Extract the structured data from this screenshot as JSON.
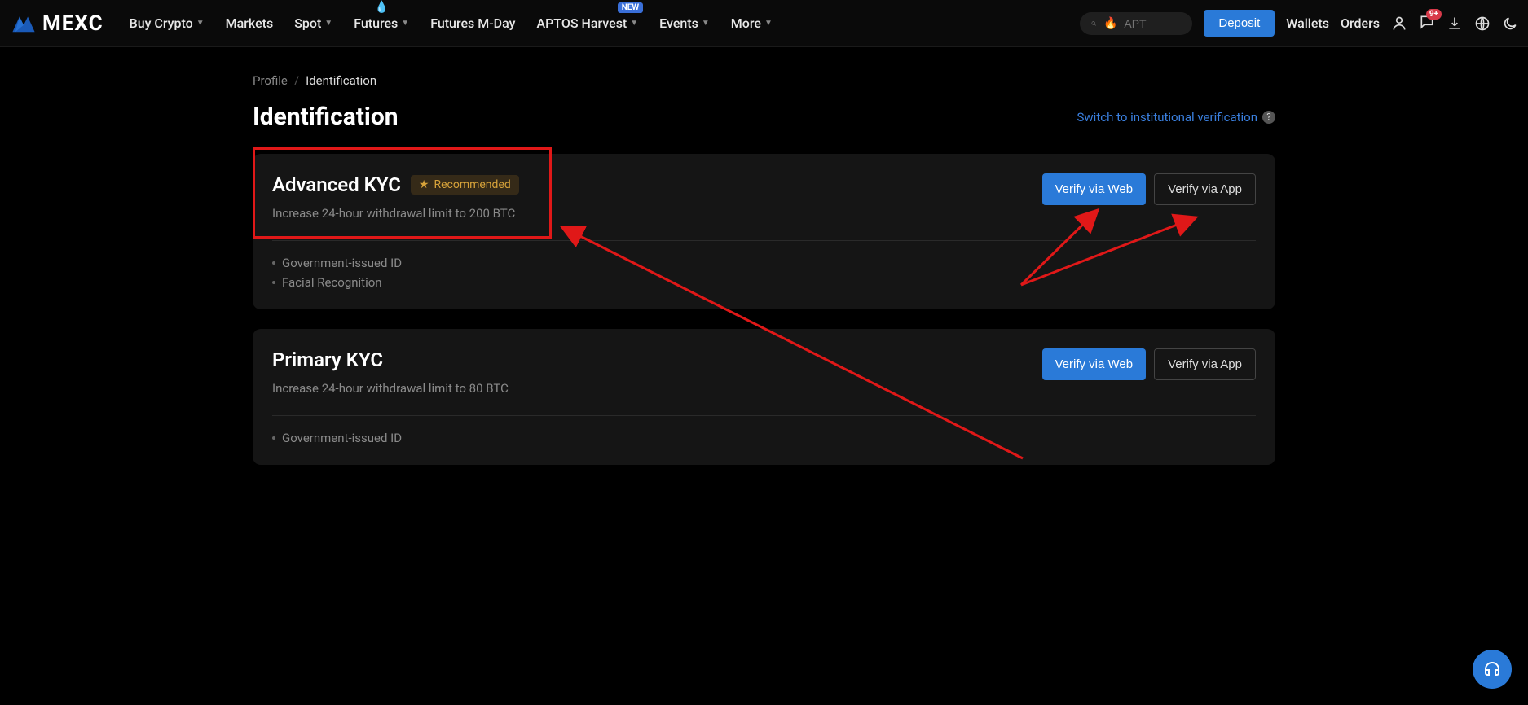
{
  "logo_text": "MEXC",
  "nav": [
    {
      "label": "Buy Crypto",
      "has_caret": true
    },
    {
      "label": "Markets",
      "has_caret": false
    },
    {
      "label": "Spot",
      "has_caret": true
    },
    {
      "label": "Futures",
      "has_caret": true,
      "fire": true
    },
    {
      "label": "Futures M-Day",
      "has_caret": false
    },
    {
      "label": "APTOS Harvest",
      "has_caret": true,
      "new_badge": "NEW"
    },
    {
      "label": "Events",
      "has_caret": true
    },
    {
      "label": "More",
      "has_caret": true
    }
  ],
  "search": {
    "placeholder": "APT"
  },
  "deposit_label": "Deposit",
  "header_links": {
    "wallets": "Wallets",
    "orders": "Orders"
  },
  "notif_badge": "9+",
  "breadcrumb": {
    "parent": "Profile",
    "current": "Identification"
  },
  "page_title": "Identification",
  "switch_link": "Switch to institutional verification",
  "cards": {
    "advanced": {
      "title": "Advanced KYC",
      "recommended": "Recommended",
      "subtitle": "Increase 24-hour withdrawal limit to 200 BTC",
      "verify_web": "Verify via Web",
      "verify_app": "Verify via App",
      "reqs": [
        "Government-issued ID",
        "Facial Recognition"
      ]
    },
    "primary": {
      "title": "Primary KYC",
      "subtitle": "Increase 24-hour withdrawal limit to 80 BTC",
      "verify_web": "Verify via Web",
      "verify_app": "Verify via App",
      "reqs": [
        "Government-issued ID"
      ]
    }
  }
}
